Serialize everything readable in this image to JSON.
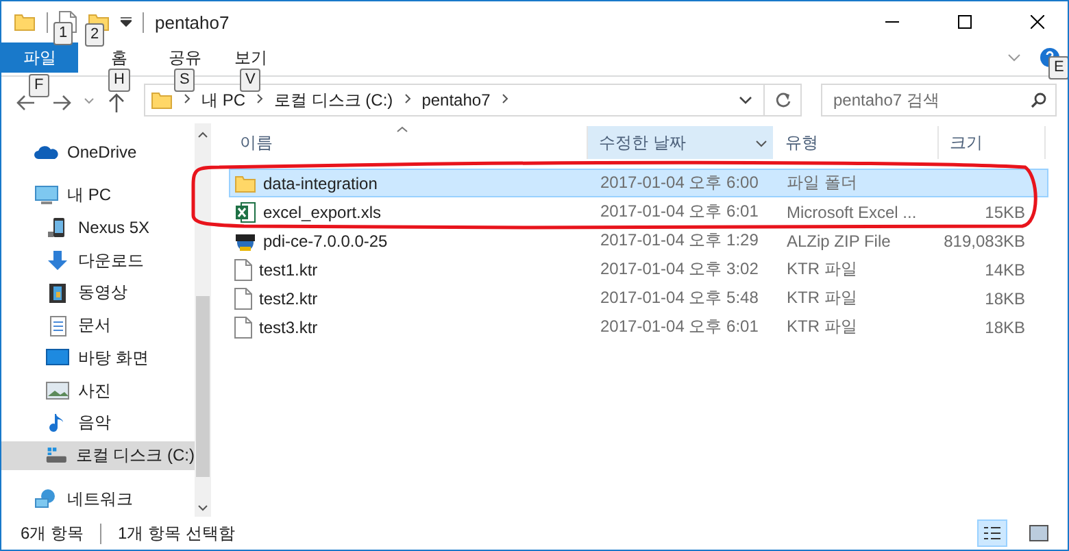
{
  "window": {
    "title": "pentaho7",
    "keytips": [
      "1",
      "2"
    ]
  },
  "ribbon": {
    "tabs": [
      {
        "label": "파일",
        "kind": "file",
        "keytip": "F"
      },
      {
        "label": "홈",
        "kind": "tab",
        "keytip": "H"
      },
      {
        "label": "공유",
        "kind": "tab",
        "keytip": "S"
      },
      {
        "label": "보기",
        "kind": "tab",
        "keytip": "V"
      }
    ],
    "help_keytip": "E"
  },
  "address": {
    "path": [
      "내 PC",
      "로컬 디스크 (C:)",
      "pentaho7"
    ]
  },
  "search": {
    "placeholder": "pentaho7 검색"
  },
  "sidebar": {
    "items": [
      {
        "label": "OneDrive",
        "kind": "onedrive",
        "selected": false
      },
      {
        "label": "내 PC",
        "kind": "pc",
        "selected": false,
        "children": [
          {
            "label": "Nexus 5X",
            "kind": "phone",
            "selected": false
          },
          {
            "label": "다운로드",
            "kind": "download",
            "selected": false
          },
          {
            "label": "동영상",
            "kind": "video",
            "selected": false
          },
          {
            "label": "문서",
            "kind": "document",
            "selected": false
          },
          {
            "label": "바탕 화면",
            "kind": "desktop",
            "selected": false
          },
          {
            "label": "사진",
            "kind": "photo",
            "selected": false
          },
          {
            "label": "음악",
            "kind": "music",
            "selected": false
          },
          {
            "label": "로컬 디스크 (C:)",
            "kind": "drive",
            "selected": true
          }
        ]
      },
      {
        "label": "네트워크",
        "kind": "network",
        "selected": false
      }
    ]
  },
  "table": {
    "columns": [
      {
        "label": "이름",
        "sorted": true,
        "hovered": false
      },
      {
        "label": "수정한 날짜",
        "sorted": false,
        "hovered": true
      },
      {
        "label": "유형",
        "sorted": false,
        "hovered": false
      },
      {
        "label": "크기",
        "sorted": false,
        "hovered": false
      }
    ],
    "rows": [
      {
        "name": "data-integration",
        "date": "2017-01-04 오후 6:00",
        "type": "파일 폴더",
        "kind": "folder",
        "selected": true
      },
      {
        "name": "excel_export.xls",
        "date": "2017-01-04 오후 6:01",
        "type": "Microsoft Excel ...",
        "size": "15KB",
        "kind": "excel",
        "selected": false
      },
      {
        "name": "pdi-ce-7.0.0.0-25",
        "date": "2017-01-04 오후 1:29",
        "type": "ALZip ZIP File",
        "size": "819,083KB",
        "kind": "zip",
        "selected": false
      },
      {
        "name": "test1.ktr",
        "date": "2017-01-04 오후 3:02",
        "type": "KTR 파일",
        "size": "14KB",
        "kind": "file",
        "selected": false
      },
      {
        "name": "test2.ktr",
        "date": "2017-01-04 오후 5:48",
        "type": "KTR 파일",
        "size": "18KB",
        "kind": "file",
        "selected": false
      },
      {
        "name": "test3.ktr",
        "date": "2017-01-04 오후 6:01",
        "type": "KTR 파일",
        "size": "18KB",
        "kind": "file",
        "selected": false
      }
    ]
  },
  "status_bar": {
    "count": "6개 항목",
    "selection": "1개 항목 선택함"
  }
}
